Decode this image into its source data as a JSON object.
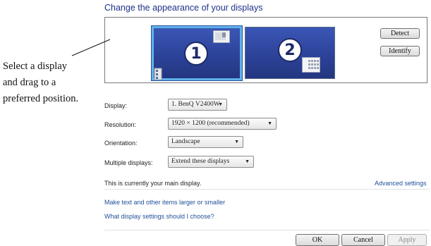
{
  "heading": "Change the appearance of your displays",
  "preview": {
    "monitor1_number": "1",
    "monitor2_number": "2",
    "selected_monitor": "1",
    "detect_label": "Detect",
    "identify_label": "Identify"
  },
  "caption": {
    "line1": "Select a display",
    "line2": "and drag to a",
    "line3": "preferred position."
  },
  "settings": {
    "display_label": "Display:",
    "display_value": "1. BenQ V2400W",
    "resolution_label": "Resolution:",
    "resolution_value": "1920 × 1200 (recommended)",
    "orientation_label": "Orientation:",
    "orientation_value": "Landscape",
    "multiple_label": "Multiple displays:",
    "multiple_value": "Extend these displays"
  },
  "status_text": "This is currently your main display.",
  "advanced_link": "Advanced settings",
  "links": {
    "text_size": "Make text and other items larger or smaller",
    "help": "What display settings should I choose?"
  },
  "buttons": {
    "ok": "OK",
    "cancel": "Cancel",
    "apply": "Apply"
  },
  "colors": {
    "link": "#1e4f9a",
    "heading": "#1e3287",
    "monitor_fill": "#2d4399",
    "selected_border": "#5fb2e8"
  }
}
